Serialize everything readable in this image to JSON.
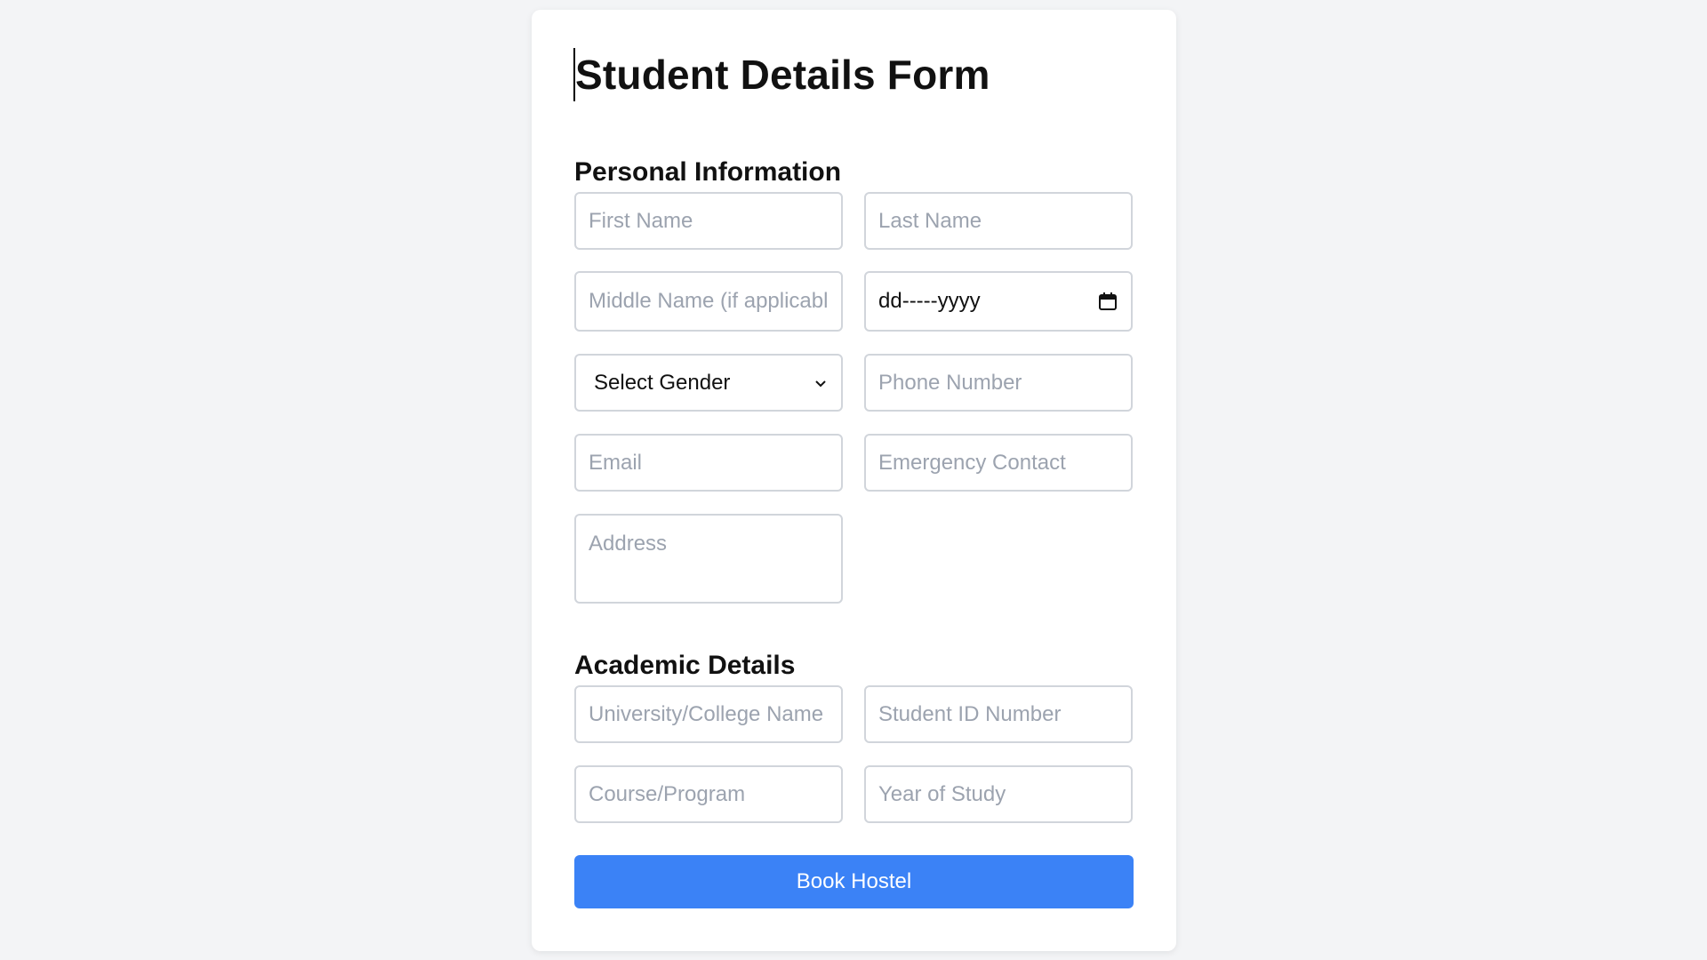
{
  "form": {
    "title": "Student Details Form",
    "personal_heading": "Personal Information",
    "academic_heading": "Academic Details",
    "first_name_placeholder": "First Name",
    "last_name_placeholder": "Last Name",
    "middle_name_placeholder": "Middle Name (if applicable)",
    "dob_value": "dd-----yyyy",
    "gender_selected": "Select Gender",
    "phone_placeholder": "Phone Number",
    "email_placeholder": "Email",
    "emergency_placeholder": "Emergency Contact",
    "address_placeholder": "Address",
    "university_placeholder": "University/College Name",
    "student_id_placeholder": "Student ID Number",
    "course_placeholder": "Course/Program",
    "year_placeholder": "Year of Study",
    "submit_label": "Book Hostel"
  },
  "colors": {
    "page_bg": "#f3f4f6",
    "button": "#3b82f6",
    "border": "#d1d5db",
    "placeholder": "#9ca3af"
  },
  "icons": {
    "dropdown": "chevron-down-icon",
    "date": "calendar-icon"
  }
}
